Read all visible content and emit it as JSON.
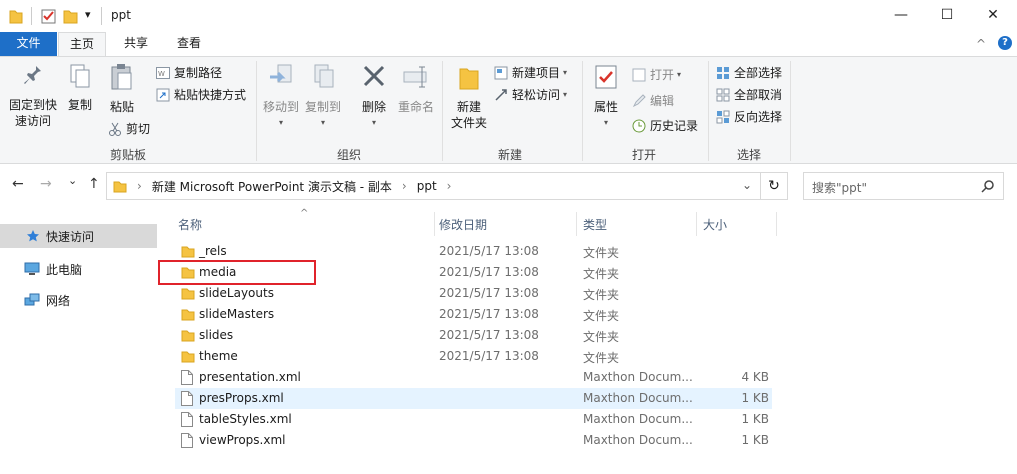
{
  "window": {
    "title": "ppt",
    "minimize": "—",
    "maximize": "☐",
    "close": "✕",
    "qa_caret": "▾"
  },
  "ribbon_tabs": {
    "file": "文件",
    "home": "主页",
    "share": "共享",
    "view": "查看",
    "collapse": "^",
    "help": "?"
  },
  "ribbon": {
    "clipboard": {
      "label": "剪贴板",
      "pin": [
        "固定到快",
        "速访问"
      ],
      "copy": "复制",
      "paste": "粘贴",
      "copy_path": "复制路径",
      "paste_shortcut": "粘贴快捷方式",
      "cut": "剪切"
    },
    "organize": {
      "label": "组织",
      "move_to": "移动到",
      "copy_to": "复制到",
      "delete": "删除",
      "rename": "重命名"
    },
    "new": {
      "label": "新建",
      "new_folder": [
        "新建",
        "文件夹"
      ],
      "new_item": "新建项目",
      "easy_access": "轻松访问"
    },
    "open": {
      "label": "打开",
      "properties": "属性",
      "open": "打开",
      "edit": "编辑",
      "history": "历史记录"
    },
    "select": {
      "label": "选择",
      "select_all": "全部选择",
      "select_none": "全部取消",
      "invert": "反向选择"
    }
  },
  "nav": {
    "back": "←",
    "forward": "→",
    "recent": "⌄",
    "up": "↑",
    "breadcrumb": [
      "新建 Microsoft PowerPoint 演示文稿 - 副本",
      "ppt"
    ],
    "crumb_sep": "›",
    "dropdown": "⌄",
    "refresh": "↻",
    "search_placeholder": "搜索\"ppt\""
  },
  "sidebar": {
    "items": [
      {
        "label": "快速访问",
        "icon": "star-icon"
      },
      {
        "label": "此电脑",
        "icon": "computer-icon"
      },
      {
        "label": "网络",
        "icon": "network-icon"
      }
    ]
  },
  "columns": {
    "name": "名称",
    "date": "修改日期",
    "type": "类型",
    "size": "大小",
    "sort_indicator": "^"
  },
  "files": [
    {
      "name": "_rels",
      "date": "2021/5/17 13:08",
      "type": "文件夹",
      "size": "",
      "kind": "folder"
    },
    {
      "name": "media",
      "date": "2021/5/17 13:08",
      "type": "文件夹",
      "size": "",
      "kind": "folder"
    },
    {
      "name": "slideLayouts",
      "date": "2021/5/17 13:08",
      "type": "文件夹",
      "size": "",
      "kind": "folder"
    },
    {
      "name": "slideMasters",
      "date": "2021/5/17 13:08",
      "type": "文件夹",
      "size": "",
      "kind": "folder"
    },
    {
      "name": "slides",
      "date": "2021/5/17 13:08",
      "type": "文件夹",
      "size": "",
      "kind": "folder"
    },
    {
      "name": "theme",
      "date": "2021/5/17 13:08",
      "type": "文件夹",
      "size": "",
      "kind": "folder"
    },
    {
      "name": "presentation.xml",
      "date": "",
      "type": "Maxthon Docum...",
      "size": "4 KB",
      "kind": "file"
    },
    {
      "name": "presProps.xml",
      "date": "",
      "type": "Maxthon Docum...",
      "size": "1 KB",
      "kind": "file"
    },
    {
      "name": "tableStyles.xml",
      "date": "",
      "type": "Maxthon Docum...",
      "size": "1 KB",
      "kind": "file"
    },
    {
      "name": "viewProps.xml",
      "date": "",
      "type": "Maxthon Docum...",
      "size": "1 KB",
      "kind": "file"
    }
  ],
  "colors": {
    "accent": "#1e6fc8",
    "folder": "#f5c342",
    "highlight_row": "#e5f3ff",
    "annotation": "#e0232b"
  }
}
